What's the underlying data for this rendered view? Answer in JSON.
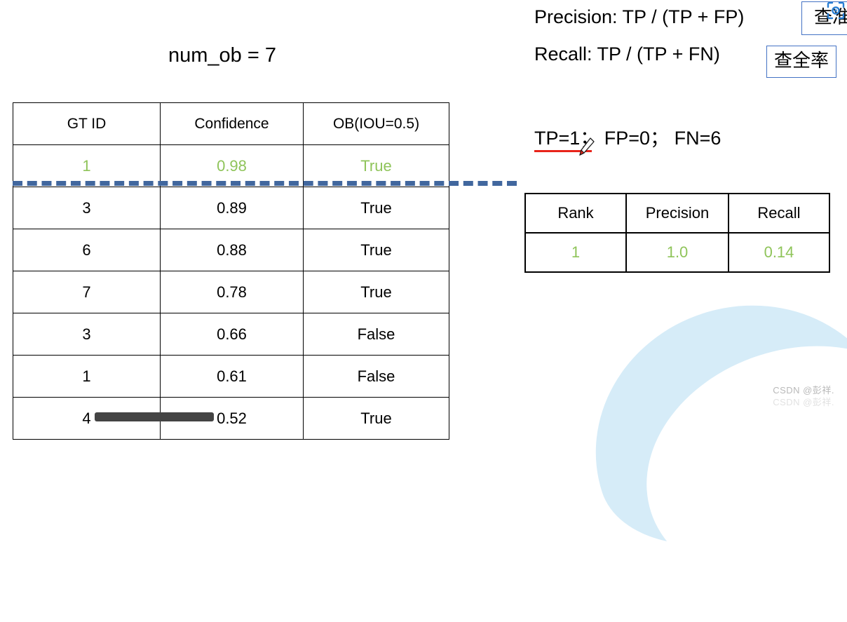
{
  "left_panel": {
    "title": "num_ob = 7",
    "detections_table": {
      "headers": [
        "GT ID",
        "Confidence",
        "OB(IOU=0.5)"
      ],
      "rows": [
        {
          "gt_id": "1",
          "confidence": "0.98",
          "ob": "True",
          "highlight": true
        },
        {
          "gt_id": "3",
          "confidence": "0.89",
          "ob": "True",
          "highlight": false
        },
        {
          "gt_id": "6",
          "confidence": "0.88",
          "ob": "True",
          "highlight": false
        },
        {
          "gt_id": "7",
          "confidence": "0.78",
          "ob": "True",
          "highlight": false
        },
        {
          "gt_id": "3",
          "confidence": "0.66",
          "ob": "False",
          "highlight": false
        },
        {
          "gt_id": "1",
          "confidence": "0.61",
          "ob": "False",
          "highlight": false
        },
        {
          "gt_id": "4",
          "confidence": "0.52",
          "ob": "True",
          "highlight": false
        }
      ]
    }
  },
  "right_panel": {
    "precision_formula": "Precision: TP / (TP + FP)",
    "recall_formula": "Recall: TP / (TP + FN)",
    "precision_cn_label": "查准率",
    "recall_cn_label": "查全率",
    "counts_line": "TP=1；  FP=0；  FN=6",
    "result_table": {
      "headers": [
        "Rank",
        "Precision",
        "Recall"
      ],
      "rows": [
        {
          "rank": "1",
          "precision": "1.0",
          "recall": "0.14"
        }
      ]
    }
  },
  "watermark": {
    "line1": "CSDN @彭祥.",
    "line2": "CSDN @彭祥."
  },
  "colors": {
    "highlight_green": "#8fc45a",
    "dashed_blue": "#41679e",
    "box_border_blue": "#4472c4",
    "underline_red": "#e8241a",
    "corner_blue": "#d6ecf8"
  }
}
